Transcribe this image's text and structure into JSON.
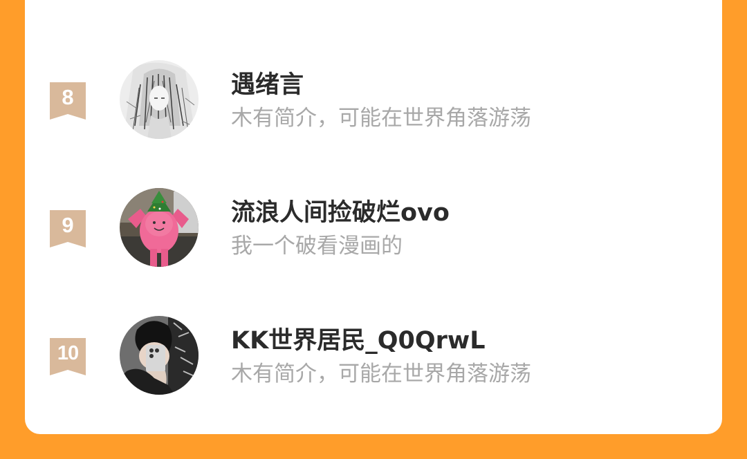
{
  "colors": {
    "page_background": "#FF9D2A",
    "card_background": "#FFFFFF",
    "rank_ribbon": "#D9B99B",
    "name_text": "#2B2B2B",
    "bio_text": "#A8A8A8"
  },
  "users": [
    {
      "rank": "8",
      "name": "遇绪言",
      "bio": "木有简介，可能在世界角落游荡",
      "avatar_icon": "anime-girl-sketch-avatar"
    },
    {
      "rank": "9",
      "name": "流浪人间捡破烂ovo",
      "bio": "我一个破看漫画的",
      "avatar_icon": "pink-figure-christmas-tree-avatar"
    },
    {
      "rank": "10",
      "name": "KK世界居民_Q0QrwL",
      "bio": "木有简介，可能在世界角落游荡",
      "avatar_icon": "mirror-selfie-avatar"
    }
  ]
}
